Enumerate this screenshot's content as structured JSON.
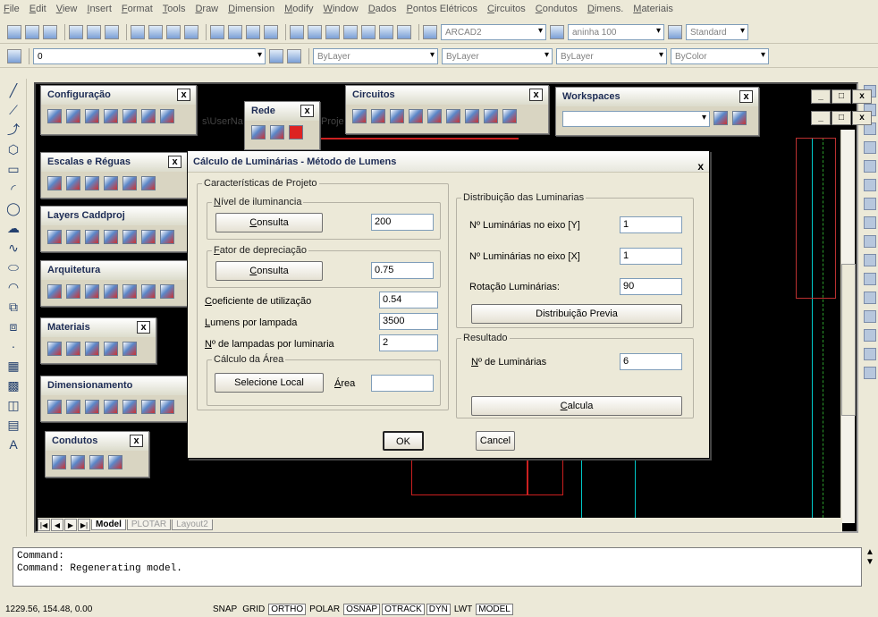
{
  "menu": [
    "File",
    "Edit",
    "View",
    "Insert",
    "Format",
    "Tools",
    "Draw",
    "Dimension",
    "Modify",
    "Window",
    "Dados",
    "Pontos Elétricos",
    "Circuitos",
    "Condutos",
    "Dimens.",
    "Materiais"
  ],
  "toolbar": {
    "textstyle": "ARCAD2",
    "dimstyle": "aninha 100",
    "tablestyle": "Standard",
    "layer": "0",
    "color": "ByLayer",
    "linetype": "ByLayer",
    "lineweight": "ByLayer",
    "plotstyle": "ByColor"
  },
  "palettes": {
    "configuracao": "Configuração",
    "rede": "Rede",
    "circuitos": "Circuitos",
    "workspaces": "Workspaces",
    "escalas": "Escalas e Réguas",
    "layers": "Layers Caddproj",
    "arquitetura": "Arquitetura",
    "materiais": "Materiais",
    "dimensionamento": "Dimensionamento",
    "condutos": "Condutos",
    "close": "x",
    "path_fragment_1": "s\\UserNa",
    "path_fragment_2": "Proje"
  },
  "layout_tabs": [
    "Model",
    "PLOTAR",
    "Layout2"
  ],
  "dialog": {
    "title": "Cálculo de Luminárias - Método de Lumens",
    "close": "x",
    "project_group": "Características de Projeto",
    "illuminance_group": "Nível de iluminancia",
    "consulta_label": "Consulta",
    "illuminance_value": "200",
    "depreciation_group": "Fator de depreciação",
    "depreciation_value": "0.75",
    "utilization_label": "Coeficiente de utilização",
    "utilization_value": "0.54",
    "lumens_label": "Lumens por lampada",
    "lumens_value": "3500",
    "lamps_label": "Nº de lampadas por luminaria",
    "lamps_value": "2",
    "area_group": "Cálculo da Área",
    "select_local": "Selecione Local",
    "area_label": "Área",
    "area_value": "",
    "distribution_group": "Distribuição das Luminarias",
    "axis_y_label": "Nº Luminárias no eixo [Y]",
    "axis_y_value": "1",
    "axis_x_label": "Nº Luminárias no eixo [X]",
    "axis_x_value": "1",
    "rotation_label": "Rotação Luminárias:",
    "rotation_value": "90",
    "preview_button": "Distribuição Previa",
    "result_group": "Resultado",
    "count_label": "Nº de Luminárias",
    "count_value": "6",
    "calc_button": "Calcula",
    "ok_button": "OK",
    "cancel_button": "Cancel"
  },
  "command": {
    "line1": "Command:",
    "line2": "Command:  Regenerating model."
  },
  "status": {
    "coords": "1229.56, 154.48, 0.00",
    "toggles": [
      "SNAP",
      "GRID",
      "ORTHO",
      "POLAR",
      "OSNAP",
      "OTRACK",
      "DYN",
      "LWT",
      "MODEL"
    ]
  }
}
